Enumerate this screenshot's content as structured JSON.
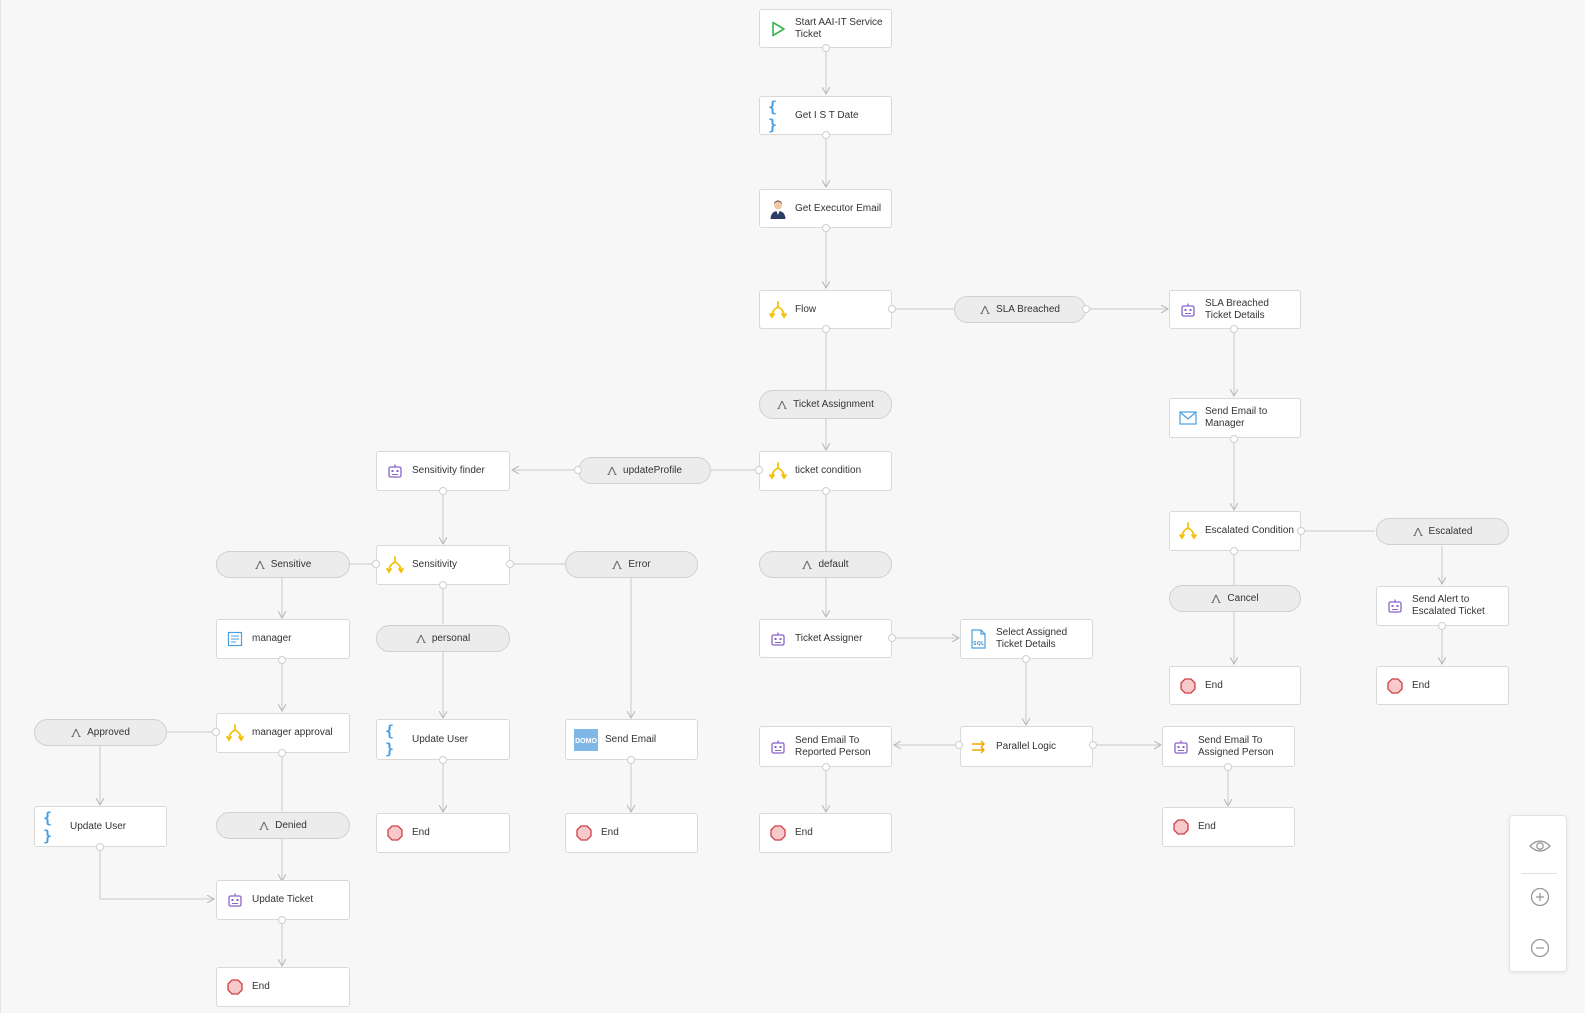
{
  "app": {
    "type": "workflow-canvas"
  },
  "nodes": {
    "start": "Start AAI-IT Service Ticket",
    "get_ist_date": "Get I S T Date",
    "get_executor_email": "Get Executor Email",
    "flow": "Flow",
    "sla_breached_details": "SLA Breached Ticket Details",
    "send_email_manager": "Send Email to Manager",
    "escalated_condition": "Escalated Condition",
    "send_alert_escalated": "Send Alert to Escalated Ticket",
    "end_cancel": "End",
    "end_escalated": "End",
    "ticket_condition": "ticket condition",
    "sensitivity_finder": "Sensitivity finder",
    "sensitivity": "Sensitivity",
    "manager": "manager",
    "manager_approval": "manager approval",
    "update_user_approved": "Update User",
    "update_ticket": "Update Ticket",
    "end_update_ticket": "End",
    "update_user_personal": "Update User",
    "end_personal": "End",
    "send_email_error": "Send Email",
    "end_error": "End",
    "ticket_assigner": "Ticket Assigner",
    "select_assigned_details": "Select Assigned Ticket Details",
    "parallel_logic": "Parallel Logic",
    "send_email_reported": "Send Email To Reported Person",
    "end_reported": "End",
    "send_email_assigned": "Send Email To Assigned Person",
    "end_assigned": "End"
  },
  "branches": {
    "sla_breached": "SLA Breached",
    "ticket_assignment": "Ticket Assignment",
    "update_profile": "updateProfile",
    "default": "default",
    "sensitive": "Sensitive",
    "error": "Error",
    "personal": "personal",
    "approved": "Approved",
    "denied": "Denied",
    "escalated": "Escalated",
    "cancel": "Cancel"
  },
  "controls": {
    "icons": [
      "eye-icon",
      "zoom-in-icon",
      "zoom-out-icon"
    ]
  },
  "colors": {
    "canvas_bg": "#f7f7f7",
    "node_border": "#d9d9d9",
    "pill_bg": "#ececec",
    "connector": "#c8c8c8",
    "start_green": "#3bb34a",
    "condition_yellow": "#f2c20f",
    "script_blue": "#4a9fe0",
    "bot_purple": "#8a63c9",
    "end_red": "#cf3f45",
    "parallel_orange": "#f0a500"
  }
}
